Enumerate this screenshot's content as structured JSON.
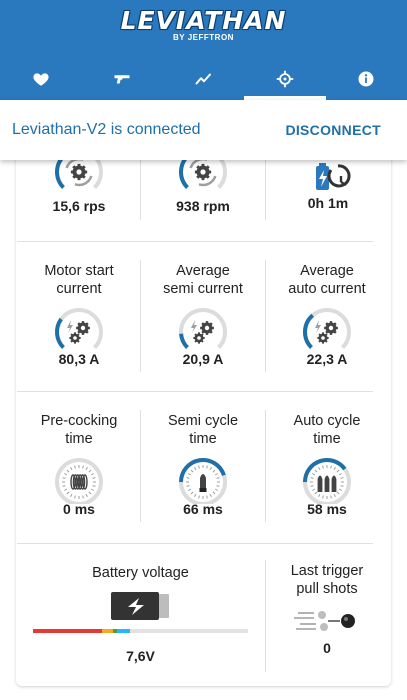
{
  "app": {
    "logo_text": "LEVIATHAN",
    "logo_subtext": "BY JEFFTRON"
  },
  "tabs": [
    {
      "icon": "heart-icon",
      "active": false
    },
    {
      "icon": "gun-icon",
      "active": false
    },
    {
      "icon": "chart-line-icon",
      "active": false
    },
    {
      "icon": "crosshair-icon",
      "active": true
    },
    {
      "icon": "info-icon",
      "active": false
    }
  ],
  "connection": {
    "status_text": "Leviathan-V2 is connected",
    "disconnect_label": "DISCONNECT"
  },
  "colors": {
    "primary": "#2a79bf",
    "gauge_fill": "#1f6fa8",
    "gauge_track": "#dcdcdc"
  },
  "row1": [
    {
      "value": "15,6 rps",
      "icon": "gear-cycle-icon",
      "level": 0.3
    },
    {
      "value": "938 rpm",
      "icon": "gear-cycle-icon",
      "level": 0.35
    },
    {
      "value": "0h 1m",
      "icon": "battery-timer-icon"
    }
  ],
  "row2": [
    {
      "label_line1": "Motor start",
      "label_line2": "current",
      "value": "80,3 A",
      "icon": "gears-lightning-icon",
      "level": 0.3
    },
    {
      "label_line1": "Average",
      "label_line2": "semi current",
      "value": "20,9 A",
      "icon": "gears-lightning-icon",
      "level": 0.15
    },
    {
      "label_line1": "Average",
      "label_line2": "auto current",
      "value": "22,3 A",
      "icon": "gears-lightning-icon",
      "level": 0.35
    }
  ],
  "row3": [
    {
      "label_line1": "Pre-cocking",
      "label_line2": "time",
      "value": "0 ms",
      "icon": "spring-icon",
      "level": 0.0
    },
    {
      "label_line1": "Semi cycle",
      "label_line2": "time",
      "value": "66 ms",
      "icon": "bullet-icon",
      "level": 0.45
    },
    {
      "label_line1": "Auto cycle",
      "label_line2": "time",
      "value": "58 ms",
      "icon": "bullets-icon",
      "level": 0.4
    }
  ],
  "battery": {
    "label": "Battery voltage",
    "value": "7,6V",
    "icon": "battery-charging-icon",
    "segments": [
      {
        "color": "#e53935",
        "fraction": 0.32
      },
      {
        "color": "#f9a825",
        "fraction": 0.05
      },
      {
        "color": "#43a047",
        "fraction": 0.02
      },
      {
        "color": "#29b6f6",
        "fraction": 0.06
      }
    ]
  },
  "last_trigger": {
    "label_line1": "Last trigger",
    "label_line2": "pull shots",
    "value": "0",
    "icon": "shots-fired-icon"
  }
}
